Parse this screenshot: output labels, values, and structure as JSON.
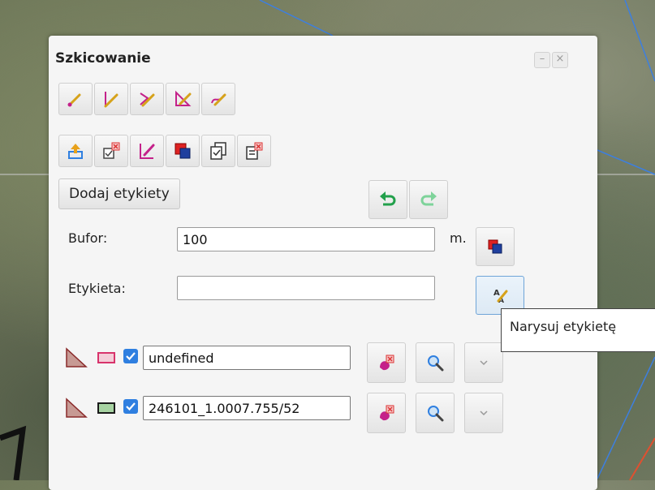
{
  "panel": {
    "title": "Szkicowanie",
    "minimize_glyph": "–",
    "close_glyph": "×"
  },
  "toolbar_draw": [
    {
      "icon": "draw-point-icon"
    },
    {
      "icon": "draw-line-icon"
    },
    {
      "icon": "draw-polyline-icon"
    },
    {
      "icon": "draw-polygon-icon"
    },
    {
      "icon": "draw-freehand-icon"
    }
  ],
  "toolbar_edit": [
    {
      "icon": "import-shape-icon"
    },
    {
      "icon": "delete-selected-icon"
    },
    {
      "icon": "edit-shape-icon"
    },
    {
      "icon": "buffer-shape-icon"
    },
    {
      "icon": "select-all-icon"
    },
    {
      "icon": "delete-all-icon"
    }
  ],
  "buttons": {
    "add_labels": "Dodaj etykiety"
  },
  "buffer": {
    "label": "Bufor:",
    "value": "100",
    "unit": "m."
  },
  "label_field": {
    "label": "Etykieta:",
    "value": ""
  },
  "tooltip": {
    "text": "Narysuj etykietę"
  },
  "layers": [
    {
      "name": "undefined",
      "outline_color": "#d8336b",
      "fill_color": "#f4cdd8",
      "checked": true
    },
    {
      "name": "246101_1.0007.755/52",
      "outline_color": "#1a1a1a",
      "fill_color": "#a7d3a2",
      "checked": true
    }
  ],
  "colors": {
    "accent_pink": "#c4218a",
    "accent_blue": "#2f7fe0",
    "undo_green": "#22a04b",
    "redo_green": "#7ed39a"
  }
}
